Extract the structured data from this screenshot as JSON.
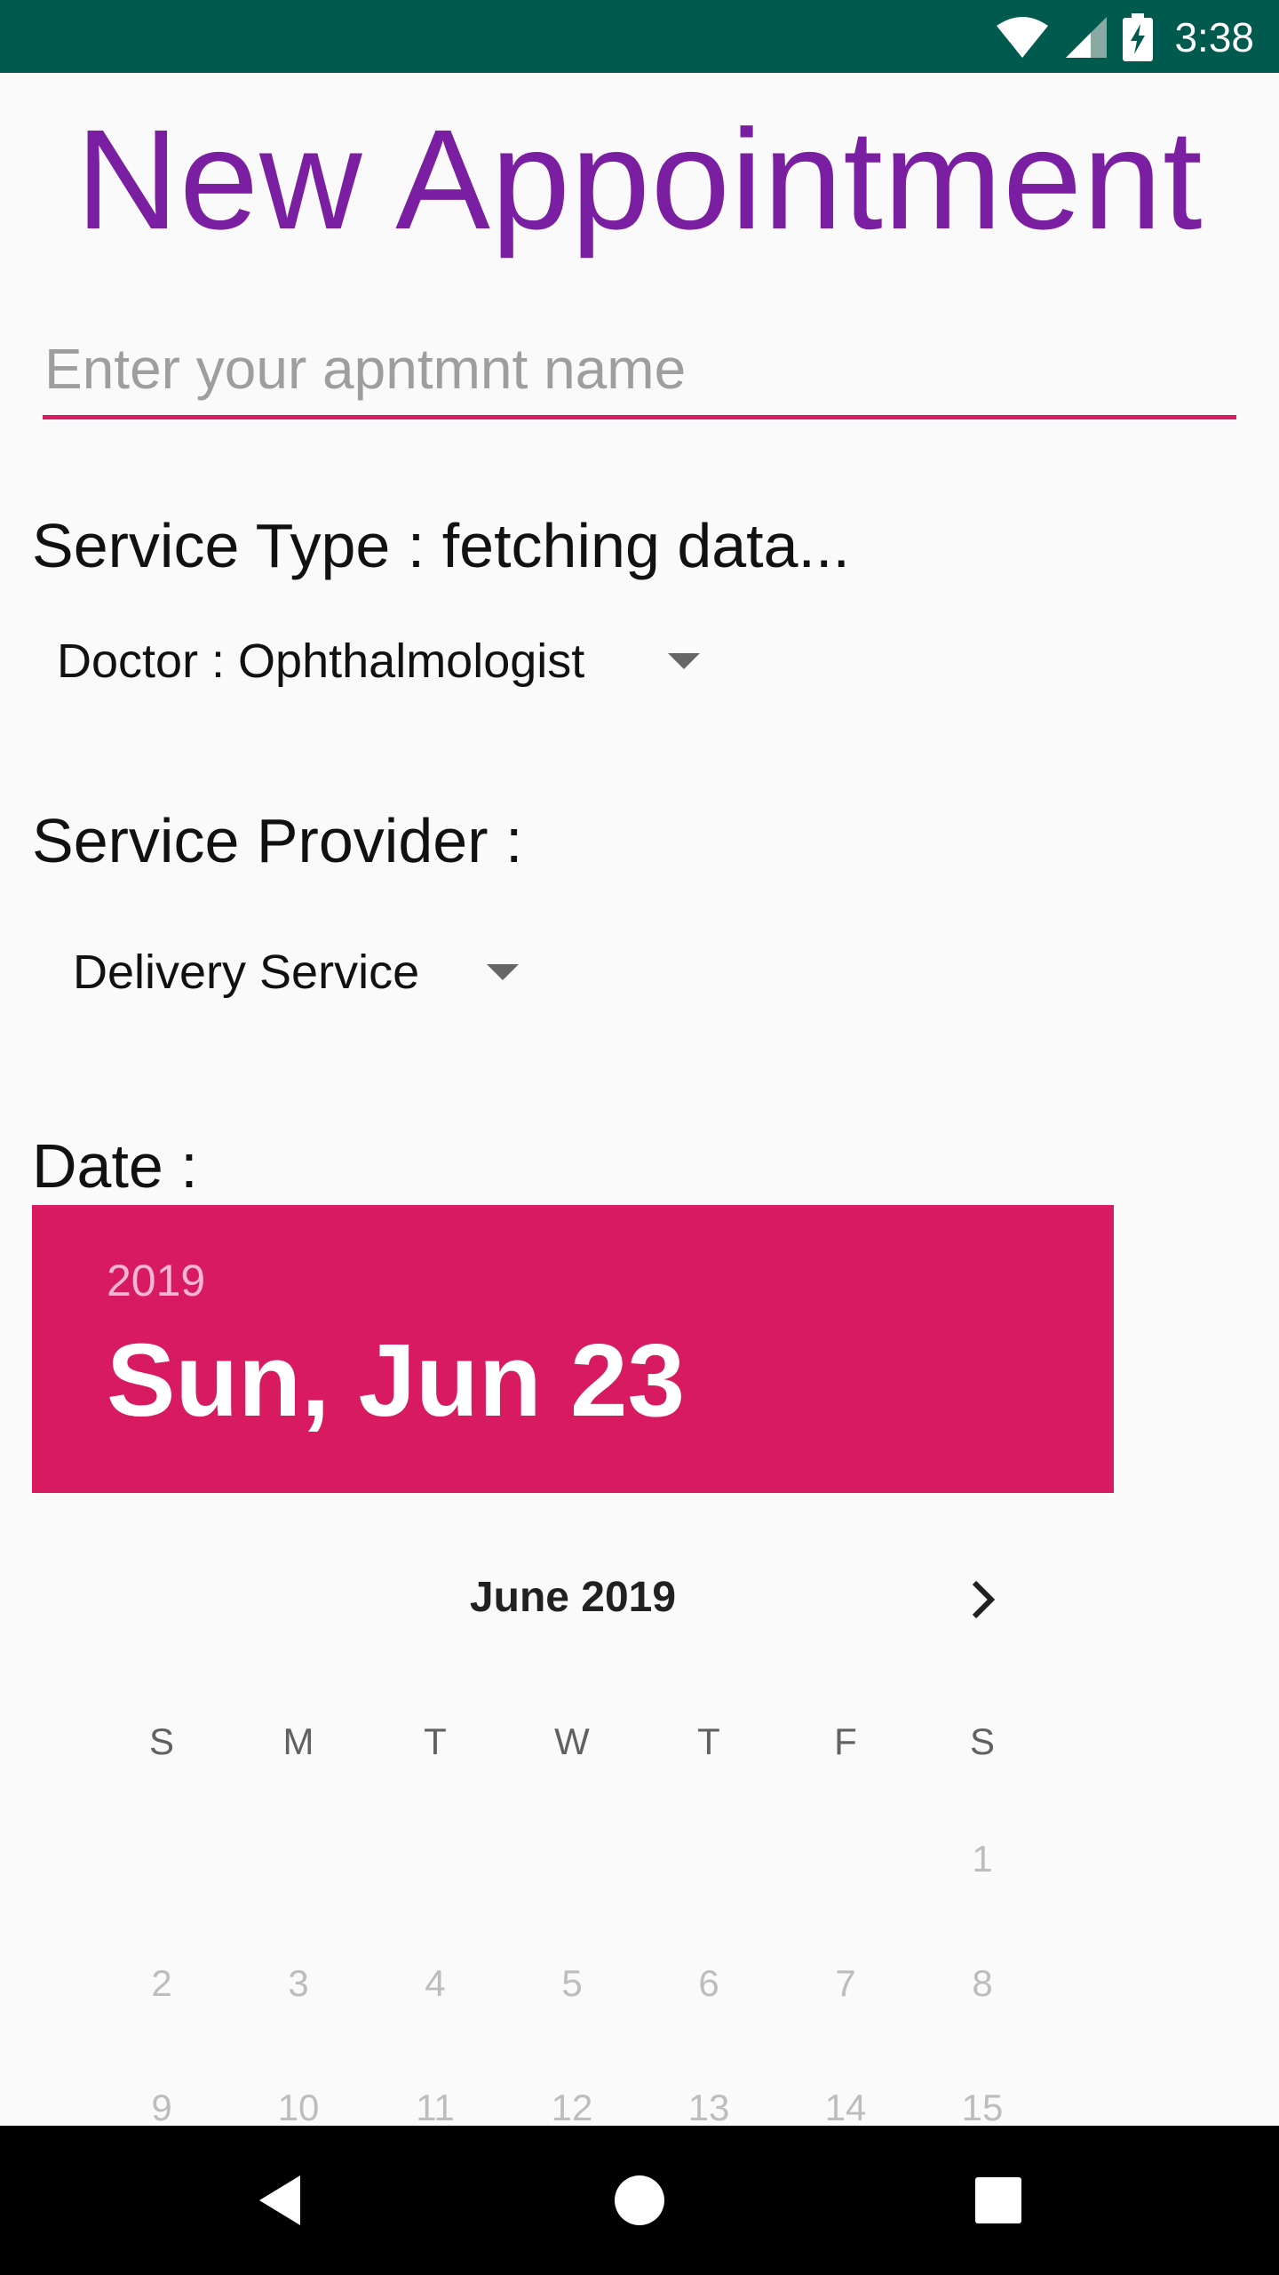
{
  "status_bar": {
    "time": "3:38",
    "icons": [
      "wifi-icon",
      "cell-signal-icon",
      "battery-charging-icon"
    ],
    "background": "#005a4e"
  },
  "page": {
    "title": "New Appointment",
    "title_color": "#7b1fa2"
  },
  "name_field": {
    "placeholder": "Enter your apntmnt name",
    "value": ""
  },
  "service_type": {
    "label": "Service Type : fetching data...",
    "selected": "Doctor : Ophthalmologist"
  },
  "service_provider": {
    "label": "Service Provider :",
    "selected": "Delivery Service"
  },
  "date": {
    "label": "Date :",
    "year": "2019",
    "full_date": "Sun, Jun 23",
    "accent": "#d81b60"
  },
  "calendar": {
    "month": "June 2019",
    "weekdays": [
      "S",
      "M",
      "T",
      "W",
      "T",
      "F",
      "S"
    ],
    "days": [
      "1",
      "2",
      "3",
      "4",
      "5",
      "6",
      "7",
      "8",
      "9",
      "10",
      "11",
      "12",
      "13",
      "14",
      "15"
    ]
  },
  "nav_bar": {
    "buttons": [
      "back-icon",
      "home-icon",
      "recents-icon"
    ]
  }
}
